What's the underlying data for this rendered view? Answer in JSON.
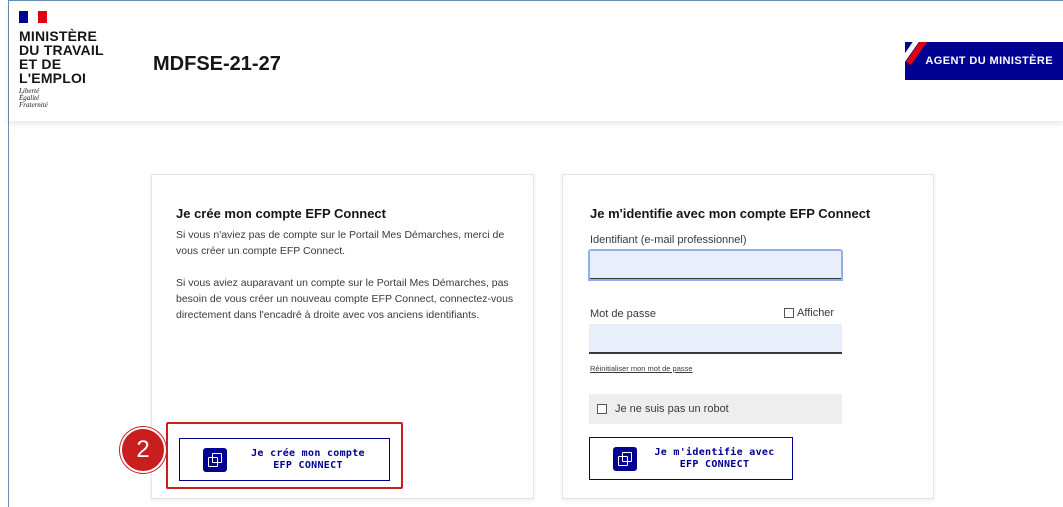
{
  "header": {
    "ministry_line1": "MINISTÈRE",
    "ministry_line2": "DU TRAVAIL",
    "ministry_line3": "ET DE L'EMPLOI",
    "motto_line1": "Liberté",
    "motto_line2": "Égalité",
    "motto_line3": "Fraternité",
    "site_title": "MDFSE-21-27",
    "agent_button": "AGENT DU MINISTÈRE"
  },
  "create_account": {
    "title": "Je crée mon compte EFP Connect",
    "paragraph1": "Si vous n'aviez pas de compte sur le Portail Mes Démarches, merci de vous créer un compte EFP Connect.",
    "paragraph2": "Si vous aviez auparavant un compte sur le Portail Mes Démarches, pas besoin de vous créer un nouveau compte EFP Connect, connectez-vous directement dans l'encadré à droite avec vos anciens identifiants.",
    "button_line1": "Je crée mon compte",
    "button_line2": "EFP CONNECT"
  },
  "login": {
    "title": "Je m'identifie avec mon compte EFP Connect",
    "identifier_label": "Identifiant (e-mail professionnel)",
    "identifier_value": "",
    "password_label": "Mot de passe",
    "password_value": "",
    "show_password_label": "Afficher",
    "show_password_checked": false,
    "reset_link": "Réinitialiser mon mot de passe",
    "captcha_label": "Je ne suis pas un robot",
    "captcha_checked": false,
    "button_line1": "Je m'identifie avec",
    "button_line2": "EFP CONNECT"
  },
  "annotation": {
    "step_number": "2",
    "color": "#c81e1e"
  },
  "colors": {
    "brand_blue": "#000091",
    "brand_red": "#e1000f",
    "input_background": "#e8effb"
  }
}
